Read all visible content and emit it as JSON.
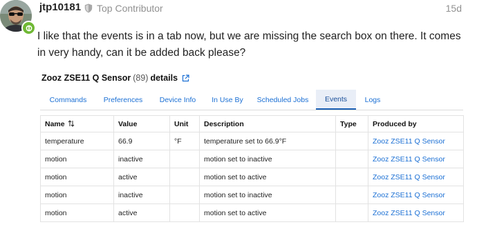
{
  "post": {
    "username": "jtp10181",
    "flair": "Top Contributor",
    "date": "15d",
    "body": "I like that the events is in a tab now, but we are missing the search box on there. It comes in very handy, can it be added back please?",
    "badge_color": "#6fb834"
  },
  "embed": {
    "device_name": "Zooz ZSE11 Q Sensor",
    "device_id": "(89)",
    "title_suffix": "details",
    "tabs": [
      {
        "label": "Commands",
        "active": false
      },
      {
        "label": "Preferences",
        "active": false
      },
      {
        "label": "Device Info",
        "active": false
      },
      {
        "label": "In Use By",
        "active": false
      },
      {
        "label": "Scheduled Jobs",
        "active": false
      },
      {
        "label": "Events",
        "active": true
      },
      {
        "label": "Logs",
        "active": false
      }
    ],
    "table": {
      "headers": [
        "Name",
        "Value",
        "Unit",
        "Description",
        "Type",
        "Produced by"
      ],
      "rows": [
        [
          "temperature",
          "66.9",
          "°F",
          "temperature set to 66.9°F",
          "",
          "Zooz ZSE11 Q Sensor"
        ],
        [
          "motion",
          "inactive",
          "",
          "motion set to inactive",
          "",
          "Zooz ZSE11 Q Sensor"
        ],
        [
          "motion",
          "active",
          "",
          "motion set to active",
          "",
          "Zooz ZSE11 Q Sensor"
        ],
        [
          "motion",
          "inactive",
          "",
          "motion set to inactive",
          "",
          "Zooz ZSE11 Q Sensor"
        ],
        [
          "motion",
          "active",
          "",
          "motion set to active",
          "",
          "Zooz ZSE11 Q Sensor"
        ]
      ]
    },
    "link_color": "#1a6fd4"
  }
}
